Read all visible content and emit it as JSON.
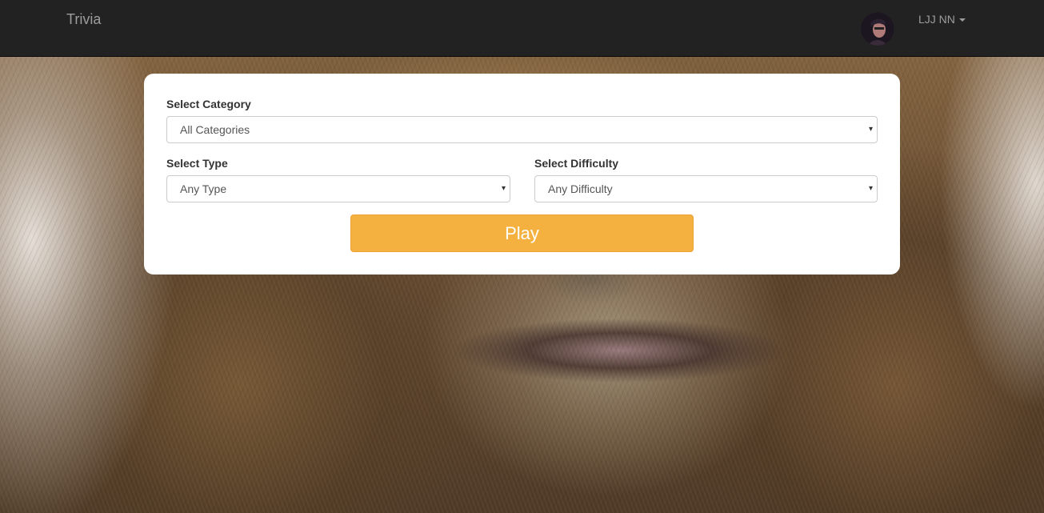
{
  "navbar": {
    "brand": "Trivia",
    "user_name": "LJJ NN"
  },
  "form": {
    "category_label": "Select Category",
    "category_value": "All Categories",
    "type_label": "Select Type",
    "type_value": "Any Type",
    "difficulty_label": "Select Difficulty",
    "difficulty_value": "Any Difficulty",
    "play_label": "Play"
  },
  "icons": {
    "select_arrow": "▾",
    "user_caret": "caret-down-icon",
    "avatar": "user-avatar"
  },
  "colors": {
    "navbar_bg": "#222222",
    "navbar_text": "#9d9d9d",
    "play_button": "#f4b13f",
    "card_bg": "#ffffff"
  }
}
